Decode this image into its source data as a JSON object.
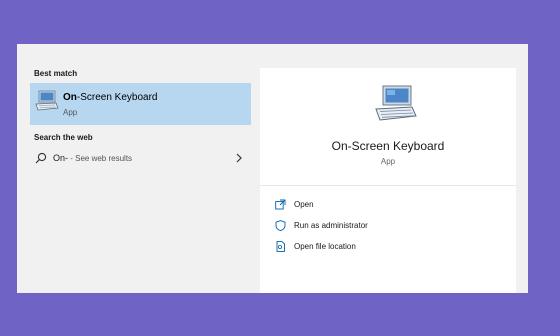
{
  "best_match": {
    "section_label": "Best match",
    "title_bold": "On",
    "title_rest": "-Screen Keyboard",
    "subtitle": "App"
  },
  "search_web": {
    "section_label": "Search the web",
    "query": "On-",
    "suffix": " - See web results"
  },
  "detail": {
    "title": "On-Screen Keyboard",
    "type": "App",
    "actions": [
      {
        "label": "Open",
        "icon": "open-icon"
      },
      {
        "label": "Run as administrator",
        "icon": "shield-icon"
      },
      {
        "label": "Open file location",
        "icon": "file-location-icon"
      }
    ]
  },
  "colors": {
    "background": "#6f64c6",
    "panel": "#f1f1f1",
    "selected": "#b7d7f0",
    "accent": "#0063b1"
  }
}
